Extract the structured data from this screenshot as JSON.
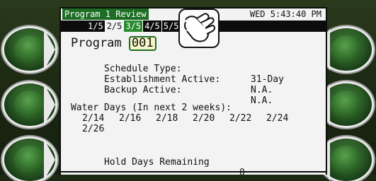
{
  "header": {
    "title": "Program 1 Review",
    "clock": "WED 5:43:40 PM"
  },
  "tabs": [
    "1/5",
    "2/5",
    "3/5",
    "4/5",
    "5/5"
  ],
  "program": {
    "label": "Program",
    "number": "001"
  },
  "fields": [
    {
      "label": "Schedule Type:",
      "value": "31-Day"
    },
    {
      "label": "Establishment Active:",
      "value": "N.A."
    },
    {
      "label": "Backup Active:",
      "value": "N.A."
    }
  ],
  "water_days": {
    "label": "Water Days (In next 2 weeks):",
    "days": [
      "2/14",
      "2/16",
      "2/18",
      "2/20",
      "2/22",
      "2/24",
      "2/26"
    ]
  },
  "hold_days": {
    "label": "Hold Days Remaining",
    "value": "0"
  },
  "icons": {
    "touch": "hand-pointer-icon"
  },
  "colors": {
    "title_bg": "#1d6e24",
    "active_tab": "#2a8a2e",
    "screen_bg": "#f3f3f3",
    "button_green": "#3a7a32"
  }
}
